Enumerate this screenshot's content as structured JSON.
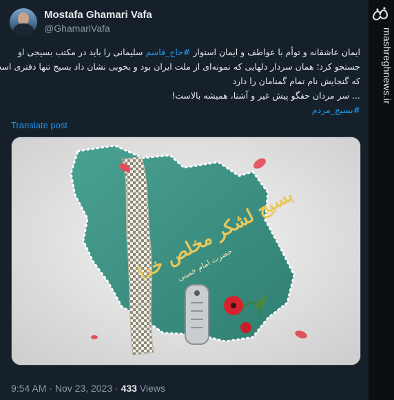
{
  "author": {
    "name": "Mostafa Ghamari Vafa",
    "handle": "@GhamariVafa"
  },
  "tweet": {
    "line1": "ایمان عاشقانه و توأم با عواطف و ایمان استوار ",
    "line1_hashtag": "#حاج_قاسم",
    "line1_rest": " سلیمانی را باید در مکتب بسیجی او",
    "line2": "جستجو کرد؛ همان سردار دلهایی که نمونه‌ای از ملت ایران بود و بخوبی نشان داد بسیج تنها دفتری است",
    "line3": "که گنجایش نام تمام گمنامان را دارد",
    "line4": "... سر مردان حقگو پیش غیر و آشنا، همیشه بالاست!",
    "hashtag": "#بسیج_مردم",
    "translate_label": "Translate post",
    "time": "9:54 AM",
    "separator": "·",
    "date": "Nov 23, 2023",
    "views_count": "433",
    "views_label": "Views"
  },
  "image": {
    "calligraphy_main": "بسیج لشکر مخلص خدا",
    "calligraphy_sub": "حضرت امام خمینی"
  },
  "watermark": {
    "url": "mashreghnews.ir"
  },
  "colors": {
    "background": "#15202b",
    "link": "#1d9bf0",
    "muted": "#8b98a5",
    "map_green": "#3a8f80"
  }
}
